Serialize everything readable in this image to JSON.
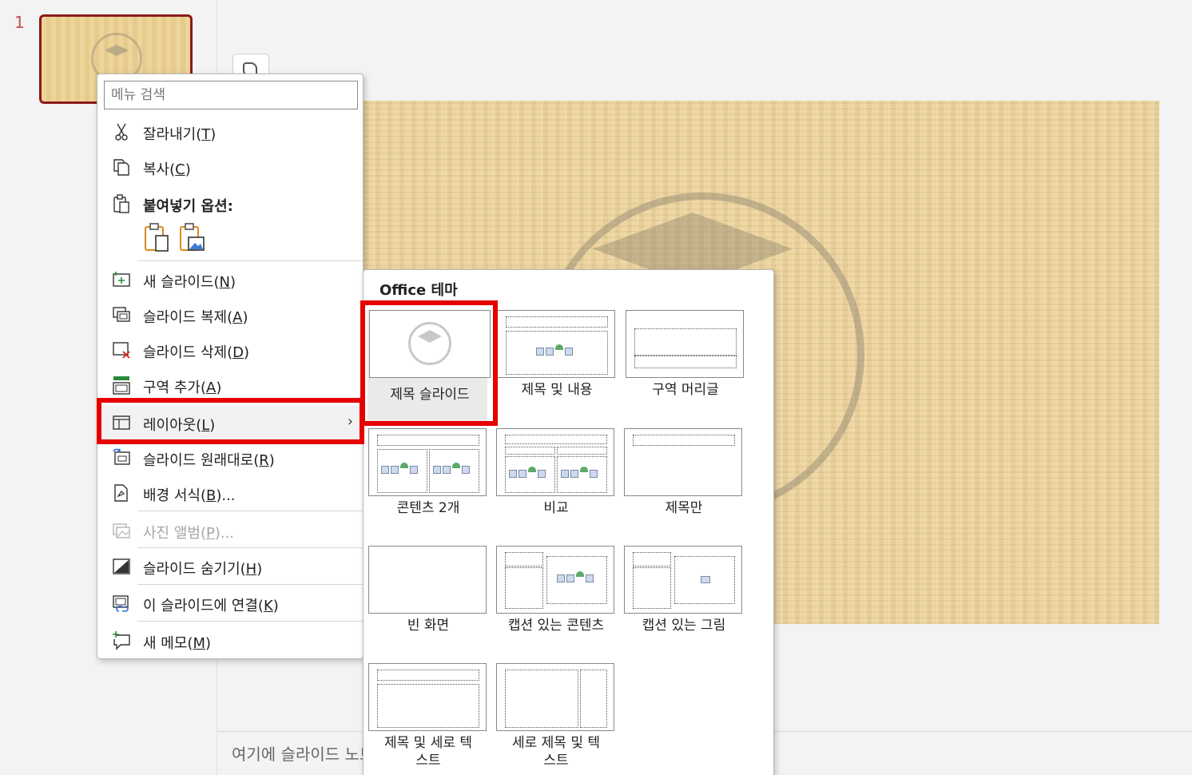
{
  "thumbnails": {
    "slide_number": "1"
  },
  "notes": {
    "placeholder": "여기에 슬라이드 노트를 추가하세요."
  },
  "context_menu": {
    "search_placeholder": "메뉴 검색",
    "items": {
      "cut": {
        "label": "잘라내기(",
        "key": "T",
        "end": ")",
        "icon": "scissors-icon"
      },
      "copy": {
        "label": "복사(",
        "key": "C",
        "end": ")",
        "icon": "copy-icon"
      },
      "paste_options": {
        "label": "붙여넣기 옵션:",
        "icon": "paste-icon"
      },
      "new_slide": {
        "label": "새 슬라이드(",
        "key": "N",
        "end": ")",
        "icon": "new-slide-icon"
      },
      "duplicate": {
        "label": "슬라이드 복제(",
        "key": "A",
        "end": ")",
        "icon": "duplicate-slide-icon"
      },
      "delete": {
        "label": "슬라이드 삭제(",
        "key": "D",
        "end": ")",
        "icon": "delete-slide-icon"
      },
      "add_section": {
        "label": "구역 추가(",
        "key": "A",
        "end": ")",
        "icon": "section-icon"
      },
      "layout": {
        "label": "레이아웃(",
        "key": "L",
        "end": ")",
        "icon": "layout-icon",
        "submenu": true
      },
      "reset": {
        "label": "슬라이드 원래대로(",
        "key": "R",
        "end": ")",
        "icon": "reset-slide-icon"
      },
      "format_bg": {
        "label": "배경 서식(",
        "key": "B",
        "end": ")...",
        "icon": "format-background-icon"
      },
      "photo_album": {
        "label": "사진 앨범(",
        "key": "P",
        "end": ")...",
        "icon": "photo-album-icon",
        "disabled": true
      },
      "hide_slide": {
        "label": "슬라이드 숨기기(",
        "key": "H",
        "end": ")",
        "icon": "hide-slide-icon"
      },
      "link_slide": {
        "label": "이 슬라이드에 연결(",
        "key": "K",
        "end": ")",
        "icon": "link-slide-icon"
      },
      "new_comment": {
        "label": "새 메모(",
        "key": "M",
        "end": ")",
        "icon": "new-comment-icon"
      }
    }
  },
  "layout_gallery": {
    "title": "Office 테마",
    "layouts": [
      {
        "id": "title-slide",
        "label": "제목 슬라이드",
        "selected": true
      },
      {
        "id": "title-content",
        "label": "제목 및 내용"
      },
      {
        "id": "section-header",
        "label": "구역 머리글"
      },
      {
        "id": "two-content",
        "label": "콘텐츠 2개"
      },
      {
        "id": "comparison",
        "label": "비교"
      },
      {
        "id": "title-only",
        "label": "제목만"
      },
      {
        "id": "blank",
        "label": "빈 화면"
      },
      {
        "id": "content-caption",
        "label": "캡션 있는 콘텐츠"
      },
      {
        "id": "picture-caption",
        "label": "캡션 있는 그림"
      },
      {
        "id": "title-vertical-text",
        "label": "제목 및 세로 텍스트"
      },
      {
        "id": "vertical-title-text",
        "label": "세로 제목 및 텍스트"
      }
    ]
  },
  "colors": {
    "highlight": "#e60000",
    "slide_bg": "#edd39a",
    "selected_thumb_border": "#8b1a1a"
  }
}
